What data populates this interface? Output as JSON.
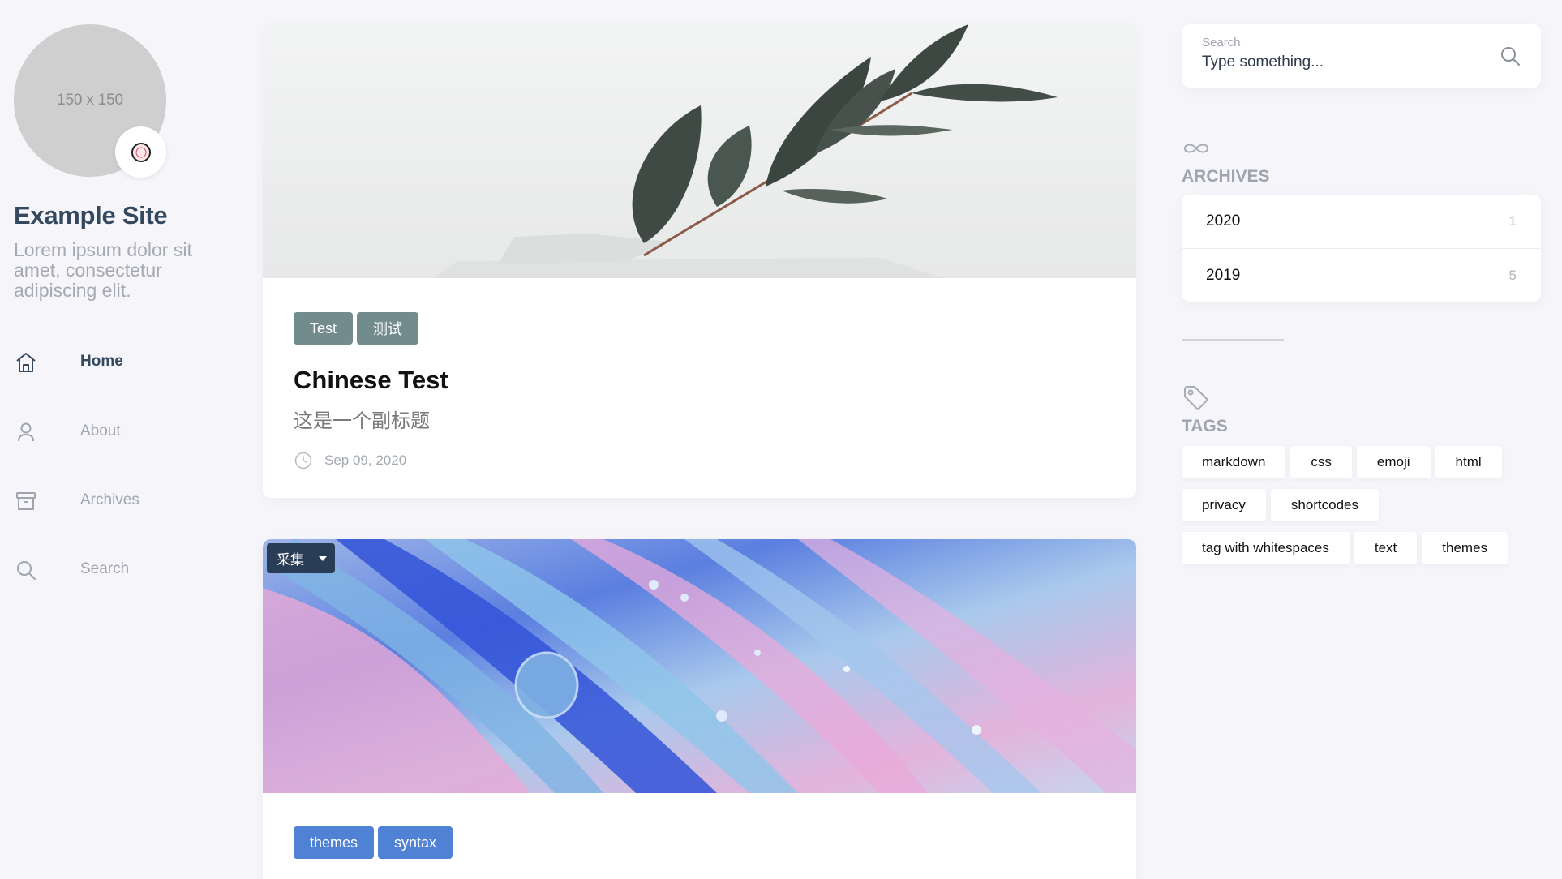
{
  "sidebar": {
    "avatar_placeholder": "150 x 150",
    "site_title": "Example Site",
    "site_description": "Lorem ipsum dolor sit amet, consectetur adipiscing elit.",
    "nav": [
      {
        "label": "Home",
        "icon": "home-icon",
        "active": true
      },
      {
        "label": "About",
        "icon": "user-icon",
        "active": false
      },
      {
        "label": "Archives",
        "icon": "archive-icon",
        "active": false
      },
      {
        "label": "Search",
        "icon": "search-icon",
        "active": false
      }
    ]
  },
  "posts": [
    {
      "tags": [
        "Test",
        "测试"
      ],
      "tag_color": "#728b8d",
      "title": "Chinese Test",
      "subtitle": "这是一个副标题",
      "date": "Sep 09, 2020"
    },
    {
      "category": "采集",
      "tags": [
        "themes",
        "syntax"
      ],
      "tag_color": "#4f82d4"
    }
  ],
  "search": {
    "label": "Search",
    "placeholder": "Type something..."
  },
  "archives": {
    "heading": "ARCHIVES",
    "items": [
      {
        "year": "2020",
        "count": "1"
      },
      {
        "year": "2019",
        "count": "5"
      }
    ]
  },
  "tags_widget": {
    "heading": "TAGS",
    "items": [
      "markdown",
      "css",
      "emoji",
      "html",
      "privacy",
      "shortcodes",
      "tag with whitespaces",
      "text",
      "themes"
    ]
  },
  "colors": {
    "accent_dark": "#34495e",
    "muted": "#a0a5ad",
    "background": "#f5f5fa"
  }
}
